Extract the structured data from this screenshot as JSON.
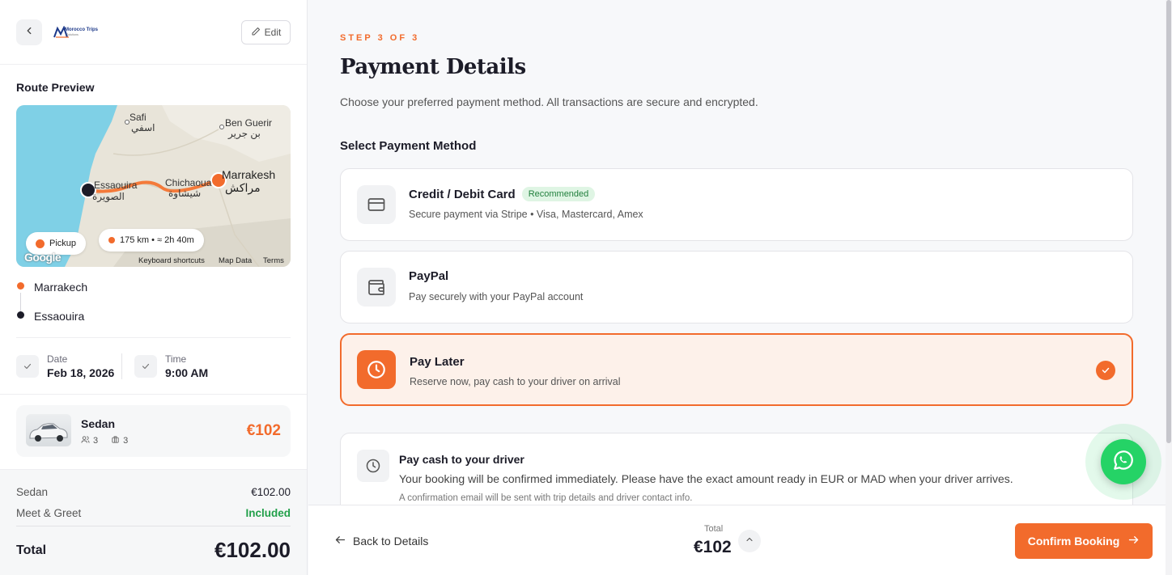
{
  "sidebar": {
    "logo_text": "Morocco Trips",
    "logo_sub": "Solutions",
    "edit_label": "Edit",
    "route_title": "Route Preview",
    "map": {
      "labels": {
        "safi": "Safi",
        "safi_ar": "اسفي",
        "ben_guerir": "Ben Guerir",
        "ben_guerir_ar": "بن جرير",
        "marrakesh": "Marrakesh",
        "marrakesh_ar": "مراكش",
        "chichaoua": "Chichaoua",
        "chichaoua_ar": "شيشاوة",
        "essaouira": "Essaouira",
        "essaouira_ar": "الصويرة"
      },
      "pickup_label": "Pickup",
      "distance_label": "175 km • ≈ 2h 40m",
      "footer": {
        "google": "Google",
        "shortcuts": "Keyboard shortcuts",
        "map_data": "Map Data",
        "terms": "Terms"
      }
    },
    "stops": {
      "from": "Marrakech",
      "to": "Essaouira"
    },
    "date": {
      "label": "Date",
      "value": "Feb 18, 2026"
    },
    "time": {
      "label": "Time",
      "value": "9:00 AM"
    },
    "vehicle": {
      "name": "Sedan",
      "passengers": "3",
      "luggage": "3",
      "price": "€102"
    },
    "summary": {
      "rows": [
        {
          "label": "Sedan",
          "value": "€102.00"
        },
        {
          "label": "Meet & Greet",
          "value": "Included"
        }
      ],
      "total_label": "Total",
      "total_value": "€102.00"
    }
  },
  "main": {
    "step": "STEP 3 OF 3",
    "title": "Payment Details",
    "subtitle": "Choose your preferred payment method. All transactions are secure and encrypted.",
    "section_title": "Select Payment Method",
    "methods": [
      {
        "name": "Credit / Debit Card",
        "badge": "Recommended",
        "desc": "Secure payment via Stripe • Visa, Mastercard, Amex",
        "icon": "credit-card-icon"
      },
      {
        "name": "PayPal",
        "desc": "Pay securely with your PayPal account",
        "icon": "wallet-icon"
      },
      {
        "name": "Pay Later",
        "desc": "Reserve now, pay cash to your driver on arrival",
        "icon": "clock-icon",
        "selected": true
      }
    ],
    "info": {
      "title": "Pay cash to your driver",
      "desc": "Your booking will be confirmed immediately. Please have the exact amount ready in EUR or MAD when your driver arrives.",
      "note": "A confirmation email will be sent with trip details and driver contact info."
    }
  },
  "bottom": {
    "back_label": "Back to Details",
    "total_label": "Total",
    "total_value": "€102",
    "confirm_label": "Confirm Booking"
  },
  "colors": {
    "accent": "#f26b2c",
    "success": "#22a04a",
    "whatsapp": "#25d366"
  }
}
